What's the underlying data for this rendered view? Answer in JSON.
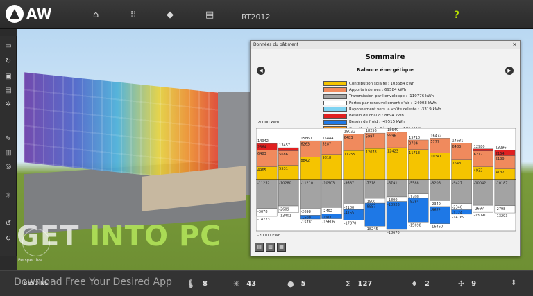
{
  "app": {
    "logo_text": "AW",
    "project_title": "RT2012",
    "help_label": "?"
  },
  "dialog": {
    "title": "Données du bâtiment",
    "close_label": "✕",
    "heading": "Sommaire",
    "subheading": "Balance énergétique",
    "prev_label": "◀",
    "next_label": "▶"
  },
  "legend": [
    {
      "label": "Contribution solaire : 103684 kWh",
      "color": "#f5c400"
    },
    {
      "label": "Apports internes : 69584 kWh",
      "color": "#f08a5d"
    },
    {
      "label": "Transmission par l'enveloppe : -110776 kWh",
      "color": "#a3a3a3"
    },
    {
      "label": "Pertes par renouvellement d'air : -24003 kWh",
      "color": "#ffffff"
    },
    {
      "label": "Rayonnement vers la voûte celeste : -3319 kWh",
      "color": "#7ed3f2"
    },
    {
      "label": "Besoin de chaud : 8694 kWh",
      "color": "#e02020"
    },
    {
      "label": "Besoin de froid : -49515 kWh",
      "color": "#1e78e6"
    },
    {
      "label": "Contribution de l'éclairage : 5814 kWh",
      "color": "#f0941e"
    }
  ],
  "chart_data": {
    "type": "bar",
    "title": "",
    "ylabel_top": "20000 kWh",
    "ylabel_bottom": "-20000 kWh",
    "ylim": [
      -20000,
      20000
    ],
    "categories": [
      "J",
      "F",
      "M",
      "A",
      "M",
      "J",
      "J",
      "A",
      "S",
      "O",
      "N",
      "D"
    ],
    "top_totals": [
      "14942",
      "13457",
      "15860",
      "15444",
      "18032",
      "18256",
      "18640",
      "15710",
      "16472",
      "14681",
      "12980",
      "13296"
    ],
    "series": [
      {
        "name": "Contribution solaire",
        "color": "#f5c400",
        "values": [
          4965,
          5531,
          8842,
          9818,
          11255,
          12078,
          12423,
          11713,
          10341,
          7648,
          4932,
          4132
        ]
      },
      {
        "name": "Apports internes",
        "color": "#f08a5d",
        "values": [
          6483,
          5686,
          6263,
          5287,
          6483,
          5997,
          5996,
          3704,
          5777,
          6483,
          6217,
          5199
        ]
      },
      {
        "name": "Besoin de chaud",
        "color": "#e02020",
        "values": [
          2564,
          1200,
          0,
          0,
          0,
          0,
          0,
          0,
          0,
          0,
          800,
          2154
        ]
      },
      {
        "name": "Transmission par l'enveloppe",
        "color": "#a3a3a3",
        "values": [
          -11252,
          -10280,
          -11210,
          -10903,
          -9587,
          -7318,
          -6741,
          -5588,
          -8206,
          -9427,
          -10042,
          -10187
        ]
      },
      {
        "name": "Pertes par renouvellement d'air",
        "color": "#ffffff",
        "values": [
          -3078,
          -2609,
          -2698,
          -2492,
          -2100,
          -1900,
          -1800,
          -1700,
          -2340,
          -2340,
          -2697,
          -2798
        ]
      },
      {
        "name": "Besoin de froid",
        "color": "#1e78e6",
        "values": [
          0,
          0,
          -1500,
          -1900,
          -4155,
          -8957,
          -10926,
          -9284,
          -6672,
          -1724,
          0,
          0
        ]
      }
    ],
    "bottom_totals": [
      "-14723",
      "-13401",
      "-15781",
      "-15606",
      "-17870",
      "-18245",
      "-18670",
      "-15698",
      "-16460",
      "-14769",
      "-13091",
      "-13293"
    ],
    "grid": false
  },
  "toolbar_icons": [
    "home-icon",
    "grid-icon",
    "hat-icon",
    "document-icon"
  ],
  "left_icons": [
    "folder-icon",
    "refresh-icon",
    "save-icon",
    "print-icon",
    "gear-icon",
    "pin-icon",
    "export-icon",
    "camera-icon",
    "sun-icon",
    "undo-icon",
    "redo-icon"
  ],
  "viewport": {
    "perspective_label": "Perspective"
  },
  "status": {
    "location": "BESOINS",
    "items": [
      {
        "icon": "thermometer-icon",
        "value": "8"
      },
      {
        "icon": "sun-icon",
        "value": "43"
      },
      {
        "icon": "bulb-icon",
        "value": "5"
      },
      {
        "icon": "sigma-icon",
        "value": "127"
      },
      {
        "icon": "drop-icon",
        "value": "2"
      },
      {
        "icon": "fan-icon",
        "value": "9"
      }
    ]
  },
  "watermark": {
    "text_a": "GET ",
    "text_b": "INTO PC",
    "sub": "Download Free Your Desired App"
  }
}
